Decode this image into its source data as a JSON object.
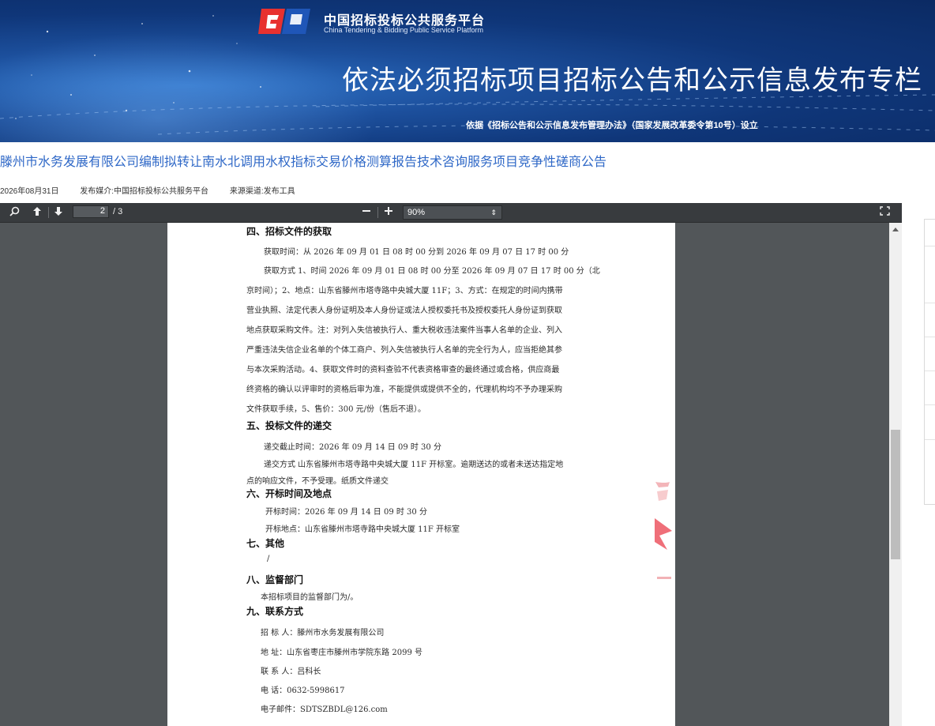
{
  "banner": {
    "brand_cn": "中国招标投标公共服务平台",
    "brand_en": "China Tendering & Bidding Public Service Platform",
    "title": "依法必须招标项目招标公告和公示信息发布专栏",
    "subtitle": "依据《招标公告和公示信息发布管理办法》（国家发展改革委令第10号）设立"
  },
  "notice": {
    "title": "滕州市水务发展有限公司编制拟转让南水北调用水权指标交易价格测算报告技术咨询服务项目竞争性磋商公告",
    "date": "2026年08月31日",
    "media": "发布媒介:中国招标投标公共服务平台",
    "source": "来源渠道:发布工具"
  },
  "viewer": {
    "page_current": "2",
    "page_count": "/ 3",
    "zoom": "90%",
    "icons": {
      "search": "search-icon",
      "prev": "arrow-up-icon",
      "next": "arrow-down-icon",
      "zoom_out": "minus-icon",
      "zoom_in": "plus-icon",
      "fullscreen": "fullscreen-icon"
    }
  },
  "pdf": {
    "s4_title": "四、招标文件的获取",
    "s4_l1": "获取时间：从 2026 年 09 月 01 日 08 时 00 分到 2026 年 09 月 07 日 17 时 00 分",
    "s4_l2": "获取方式 1、时间 2026 年 09 月 01 日 08 时 00 分至 2026 年 09 月 07 日 17 时 00 分（北",
    "s4_l3": "京时间）；2、地点：山东省滕州市塔寺路中央城大厦 11F；3、方式：在规定的时间内携带",
    "s4_l4": "营业执照、法定代表人身份证明及本人身份证或法人授权委托书及授权委托人身份证到获取",
    "s4_l5": "地点获取采购文件。注：对列入失信被执行人、重大税收违法案件当事人名单的企业、列入",
    "s4_l6": "严重违法失信企业名单的个体工商户、列入失信被执行人名单的完全行为人，应当拒绝其参",
    "s4_l7": "与本次采购活动。4、获取文件时的资料查验不代表资格审查的最终通过或合格，供应商最",
    "s4_l8": "终资格的确认以评审时的资格后审为准，不能提供或提供不全的，代理机构均不予办理采购",
    "s4_l9": "文件获取手续，5、售价：300 元/份（售后不退）。",
    "s5_title": "五、投标文件的递交",
    "s5_l1": "递交截止时间：2026 年 09 月 14 日 09 时 30 分",
    "s5_l2": "递交方式 山东省滕州市塔寺路中央城大厦 11F 开标室。逾期送达的或者未送达指定地",
    "s5_l3": "点的响应文件，不予受理。纸质文件递交",
    "s6_title": "六、开标时间及地点",
    "s6_l1": "开标时间：2026 年 09 月 14 日 09 时 30 分",
    "s6_l2": "开标地点：山东省滕州市塔寺路中央城大厦 11F 开标室",
    "s7_title": "七、其他",
    "s7_l1": "/",
    "s8_title": "八、监督部门",
    "s8_l1": "本招标项目的监督部门为/。",
    "s9_title": "九、联系方式",
    "s9_l1": "招 标 人：滕州市水务发展有限公司",
    "s9_l2": "地      址：山东省枣庄市滕州市学院东路 2099 号",
    "s9_l3": "联 系 人：吕科长",
    "s9_l4": "电      话：0632-5998617",
    "s9_l5": "电子邮件：SDTSZBDL@126.com"
  },
  "colors": {
    "link_blue": "#2f68c7",
    "banner_dark": "#0b2a63",
    "viewer_bg": "#525659",
    "toolbar_bg": "#383b3e",
    "logo_red": "#e8312f"
  }
}
